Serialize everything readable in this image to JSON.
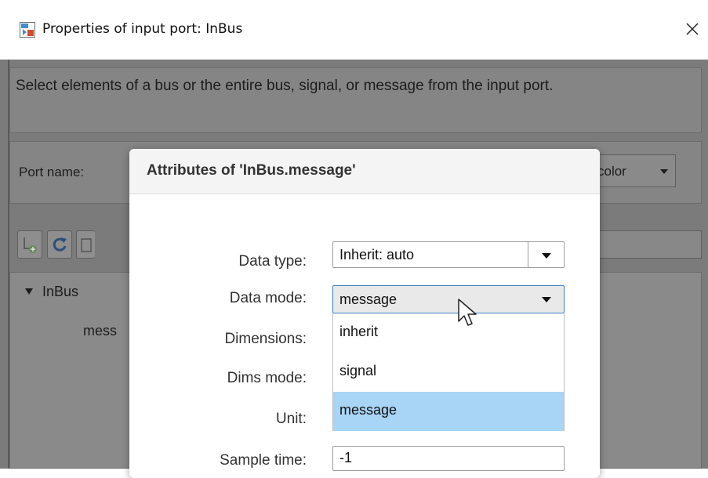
{
  "window": {
    "title": "Properties of input port: InBus",
    "close_symbol": "✕"
  },
  "background": {
    "description": "Select elements of a bus or the entire bus, signal, or message from the input port.",
    "port_name_label": "Port name:",
    "color_select_value": "color",
    "tree": {
      "bus_label": "InBus",
      "child_label": "mess"
    }
  },
  "modal": {
    "title": "Attributes of 'InBus.message'",
    "fields": {
      "data_type": {
        "label": "Data type:",
        "value": "Inherit: auto"
      },
      "data_mode": {
        "label": "Data mode:",
        "value": "message"
      },
      "dimensions": {
        "label": "Dimensions:"
      },
      "dims_mode": {
        "label": "Dims mode:"
      },
      "unit": {
        "label": "Unit:"
      },
      "sample_time": {
        "label": "Sample time:",
        "value": "-1"
      }
    },
    "dropdown_options": [
      "inherit",
      "signal",
      "message"
    ],
    "selected_option": "message"
  },
  "colors": {
    "overlay": "#7b7b7b",
    "selection": "#a8d5f5",
    "focus_border": "#3b7fc4"
  },
  "icons": {
    "app": "simulink-port-icon",
    "close": "close-icon",
    "toolbar": [
      "add-element-icon",
      "refresh-icon",
      "delete-icon"
    ],
    "cursor": "mouse-pointer-icon"
  }
}
